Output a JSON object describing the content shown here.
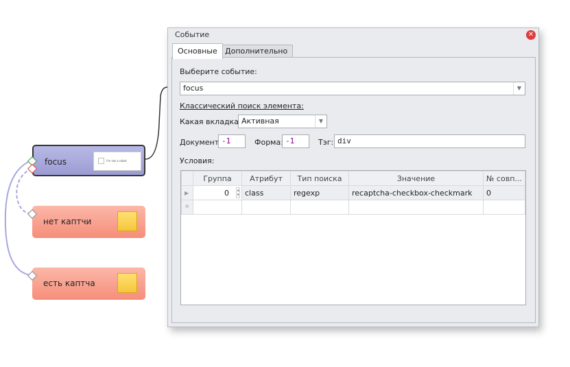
{
  "canvas": {
    "nodes": [
      {
        "label": "focus",
        "thumbnail_text": "I'm not a robot"
      },
      {
        "label": "нет каптчи"
      },
      {
        "label": "есть каптча"
      }
    ]
  },
  "dialog": {
    "title": "Событие",
    "tabs": [
      "Основные",
      "Дополнительно"
    ],
    "select_event_label": "Выберите событие:",
    "event_value": "focus",
    "classic_search_label": "Классический поиск элемента:",
    "which_tab_label": "Какая вкладка:",
    "which_tab_value": "Активная",
    "document_label": "Документ:",
    "document_value": "-1",
    "form_label": "Форма:",
    "form_value": "-1",
    "tag_label": "Тэг:",
    "tag_value": "div",
    "conditions_label": "Условия:",
    "grid": {
      "headers": [
        "Группа",
        "Атрибут",
        "Тип поиска",
        "Значение",
        "№ совп..."
      ],
      "rows": [
        [
          "0",
          "class",
          "regexp",
          "recaptcha-checkbox-checkmark",
          "0"
        ]
      ]
    }
  }
}
